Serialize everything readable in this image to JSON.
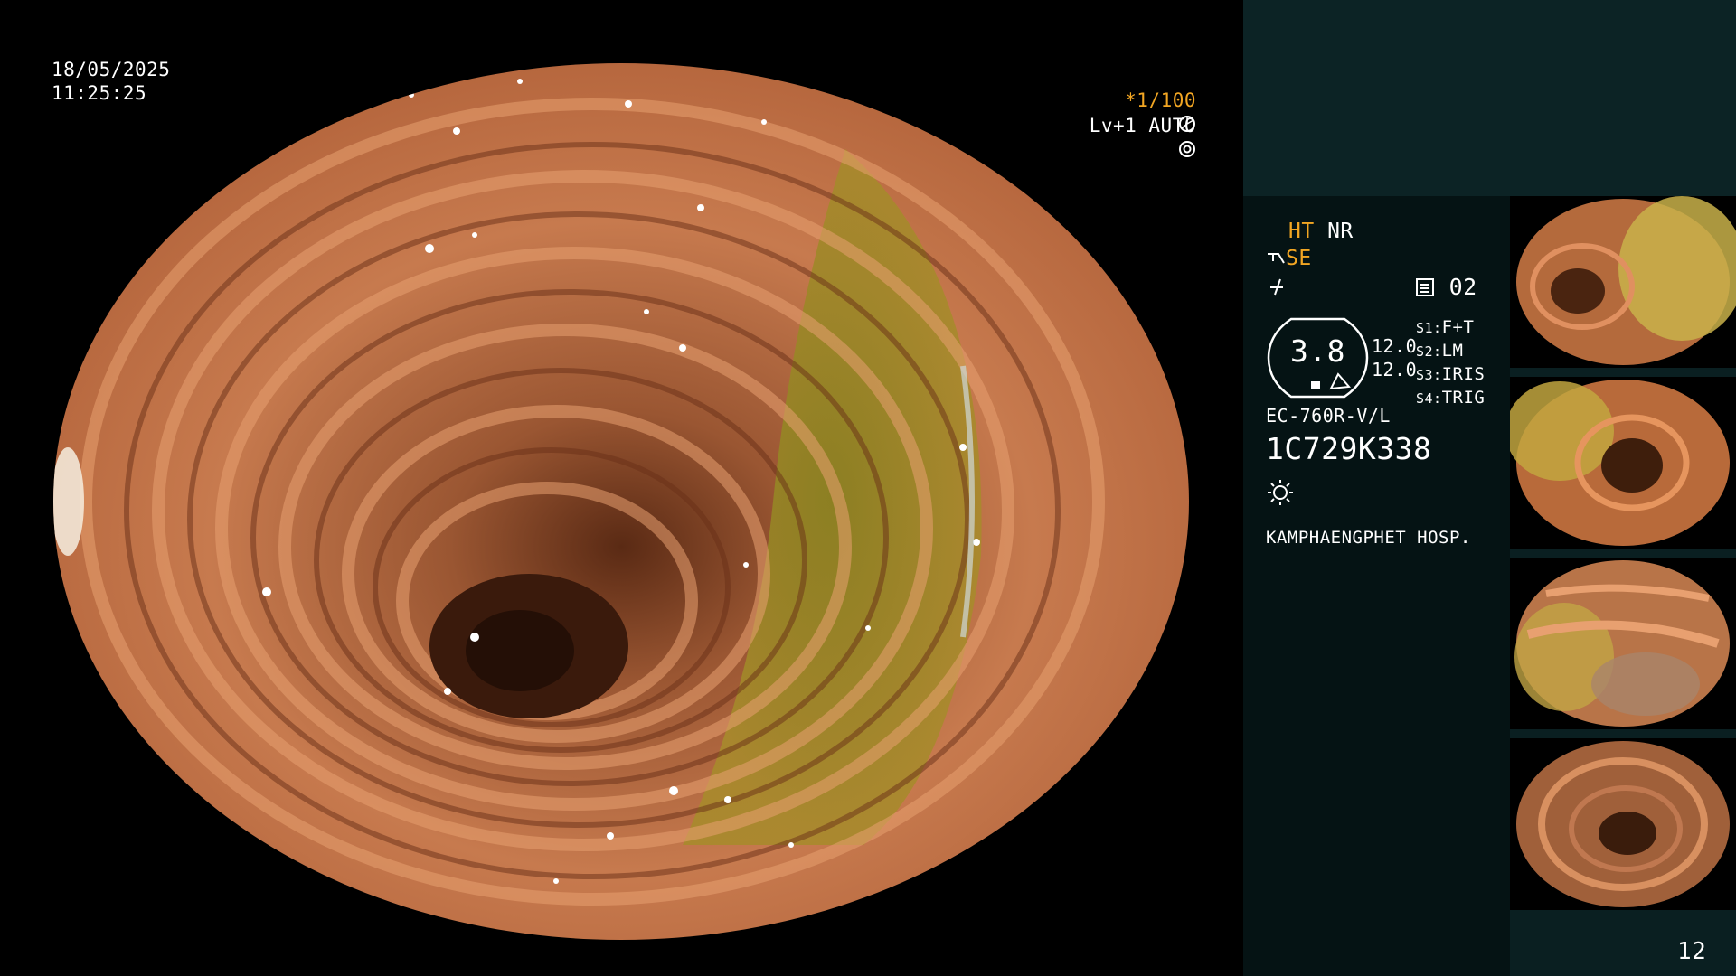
{
  "osd": {
    "date": "18/05/2025",
    "time": "11:25:25",
    "shutter": "*1/100",
    "shutter_icon": "aperture-icon",
    "enhance": "Lv+1 AUTO",
    "enhance_icon": "iris-icon"
  },
  "panel": {
    "ht": "HT",
    "nr": "NR",
    "se": "SE",
    "se_icon": "scope-icon",
    "freeze_icon": "freeze-icon",
    "memory_icon": "memory-icon",
    "memory": "02",
    "gauge_value": "3.8",
    "gauge_right_top": "12.0",
    "gauge_right_bottom": "12.0",
    "switches": [
      {
        "key": "S1:",
        "value": "F+T"
      },
      {
        "key": "S2:",
        "value": "LM"
      },
      {
        "key": "S3:",
        "value": "IRIS"
      },
      {
        "key": "S4:",
        "value": "TRIG"
      }
    ],
    "scope_model": "EC-760R-V/L",
    "serial": "1C729K338",
    "light_icon": "light-icon",
    "hospital": "KAMPHAENGPHET HOSP.",
    "page_number": "12"
  },
  "thumbnails": [
    {
      "id": "thumb-1"
    },
    {
      "id": "thumb-2"
    },
    {
      "id": "thumb-3"
    },
    {
      "id": "thumb-4"
    }
  ],
  "colors": {
    "amber": "#f2a623",
    "panel_top": "#0c2325",
    "panel_body": "#051314"
  }
}
